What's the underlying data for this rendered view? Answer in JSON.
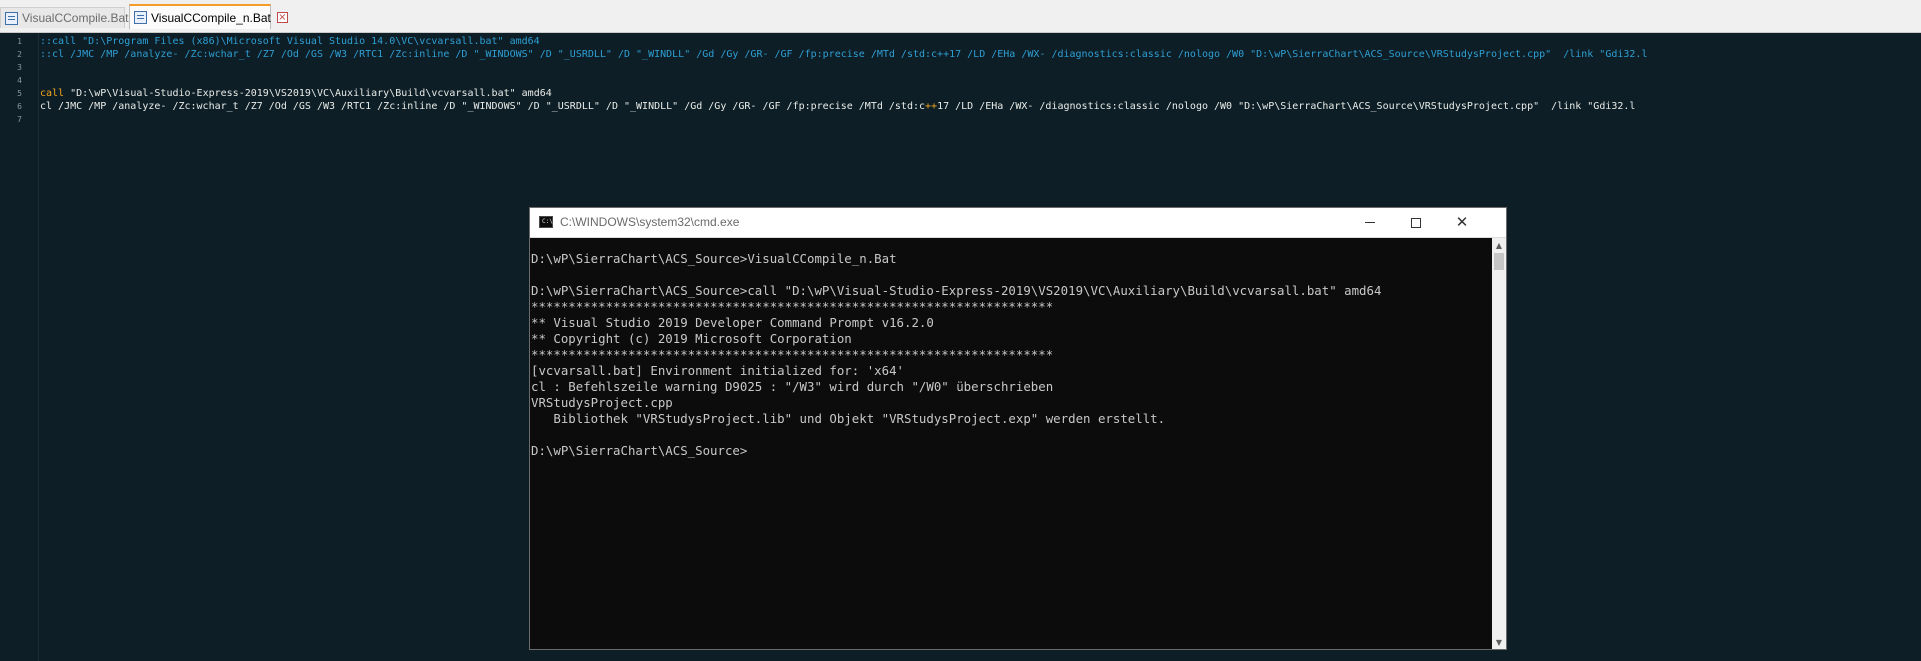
{
  "tabs": [
    {
      "label": "VisualCCompile.Bat",
      "active": false
    },
    {
      "label": "VisualCCompile_n.Bat",
      "active": true
    }
  ],
  "editor": {
    "lines": [
      {
        "number": "1",
        "segments": [
          {
            "text": "::call \"D:\\Program Files (x86)\\Microsoft Visual Studio 14.0\\VC\\vcvarsall.bat\" amd64",
            "style": "comment"
          }
        ]
      },
      {
        "number": "2",
        "segments": [
          {
            "text": "::cl /JMC /MP /analyze- /Zc:wchar_t /Z7 /Od /GS /W3 /RTC1 /Zc:inline /D \"_WINDOWS\" /D \"_USRDLL\" /D \"_WINDLL\" /Gd /Gy /GR- /GF /fp:precise /MTd /std:c++17 /LD /EHa /WX- /diagnostics:classic /nologo /W0 \"D:\\wP\\SierraChart\\ACS_Source\\VRStudysProject.cpp\"  /link \"Gdi32.l",
            "style": "comment"
          }
        ]
      },
      {
        "number": "3",
        "segments": []
      },
      {
        "number": "4",
        "segments": []
      },
      {
        "number": "5",
        "segments": [
          {
            "text": "call",
            "style": "kw"
          },
          {
            "text": " \"D:\\wP\\Visual-Studio-Express-2019\\VS2019\\VC\\Auxiliary\\Build\\vcvarsall.bat\" amd64",
            "style": "normal"
          }
        ]
      },
      {
        "number": "6",
        "segments": [
          {
            "text": "cl /JMC /MP /analyze- /Zc:wchar_t /Z7 /Od /GS /W3 /RTC1 /Zc:inline /D \"_WINDOWS\" /D \"_USRDLL\" /D \"_WINDLL\" /Gd /Gy /GR- /GF /fp:precise /MTd /std:c",
            "style": "normal"
          },
          {
            "text": "++",
            "style": "kw"
          },
          {
            "text": "17 /LD /EHa /WX- /diagnostics:classic /nologo /W0 \"D:\\wP\\SierraChart\\ACS_Source\\VRStudysProject.cpp\"  /link \"Gdi32.l",
            "style": "normal"
          }
        ]
      },
      {
        "number": "7",
        "segments": []
      }
    ]
  },
  "cmd": {
    "title": "C:\\WINDOWS\\system32\\cmd.exe",
    "lines": [
      "D:\\wP\\SierraChart\\ACS_Source>VisualCCompile_n.Bat",
      "",
      "D:\\wP\\SierraChart\\ACS_Source>call \"D:\\wP\\Visual-Studio-Express-2019\\VS2019\\VC\\Auxiliary\\Build\\vcvarsall.bat\" amd64",
      "**********************************************************************",
      "** Visual Studio 2019 Developer Command Prompt v16.2.0",
      "** Copyright (c) 2019 Microsoft Corporation",
      "**********************************************************************",
      "[vcvarsall.bat] Environment initialized for: 'x64'",
      "cl : Befehlszeile warning D9025 : \"/W3\" wird durch \"/W0\" überschrieben",
      "VRStudysProject.cpp",
      "   Bibliothek \"VRStudysProject.lib\" und Objekt \"VRStudysProject.exp\" werden erstellt.",
      "",
      "D:\\wP\\SierraChart\\ACS_Source>"
    ]
  }
}
